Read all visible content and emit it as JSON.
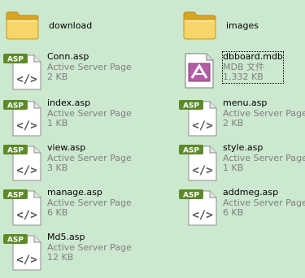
{
  "files": [
    {
      "name": "download",
      "kind": "folder"
    },
    {
      "name": "images",
      "kind": "folder"
    },
    {
      "name": "Conn.asp",
      "type": "Active Server Page",
      "size": "2 KB",
      "kind": "asp"
    },
    {
      "name": "dbboard.mdb",
      "type": "MDB 文件",
      "size": "1,332 KB",
      "kind": "mdb"
    },
    {
      "name": "index.asp",
      "type": "Active Server Page",
      "size": "1 KB",
      "kind": "asp"
    },
    {
      "name": "menu.asp",
      "type": "Active Server Page",
      "size": "2 KB",
      "kind": "asp"
    },
    {
      "name": "view.asp",
      "type": "Active Server Page",
      "size": "3 KB",
      "kind": "asp"
    },
    {
      "name": "style.asp",
      "type": "Active Server Page",
      "size": "1 KB",
      "kind": "asp"
    },
    {
      "name": "manage.asp",
      "type": "Active Server Page",
      "size": "6 KB",
      "kind": "asp"
    },
    {
      "name": "addmeg.asp",
      "type": "Active Server Page",
      "size": "6 KB",
      "kind": "asp"
    },
    {
      "name": "Md5.asp",
      "type": "Active Server Page",
      "size": "12 KB",
      "kind": "asp"
    }
  ],
  "asp_badge": "ASP",
  "colors": {
    "background": "#CCE8CF",
    "asp_badge": "#5C8A28",
    "folder": "#F2C94C",
    "secondary_text": "#808080"
  }
}
